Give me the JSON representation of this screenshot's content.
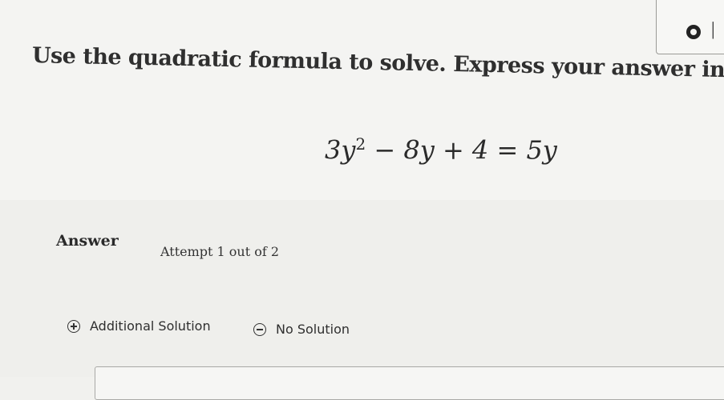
{
  "question": {
    "prompt": "Use the quadratic formula to solve. Express your answer in simpl",
    "equation": {
      "term1_coef": "3",
      "var": "y",
      "exponent": "2",
      "op1": "−",
      "term2": "8",
      "op2": "+",
      "const": "4",
      "equals": "=",
      "rhs_coef": "5"
    }
  },
  "answer": {
    "label": "Answer",
    "attempt_text": "Attempt 1 out of 2",
    "options": {
      "additional_solution": "Additional Solution",
      "no_solution": "No Solution"
    }
  },
  "icons": {
    "corner": "record-icon",
    "additional": "plus-circle-icon",
    "no_solution": "minus-circle-icon"
  }
}
